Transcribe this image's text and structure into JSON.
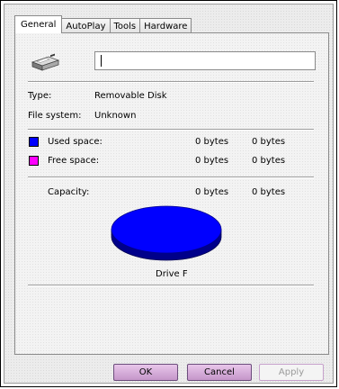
{
  "tabs": [
    {
      "label": "General",
      "active": true
    },
    {
      "label": "AutoPlay",
      "active": false
    },
    {
      "label": "Tools",
      "active": false
    },
    {
      "label": "Hardware",
      "active": false
    }
  ],
  "drive": {
    "icon": "removable-disk-icon",
    "name_value": ""
  },
  "info": {
    "type_label": "Type:",
    "type_value": "Removable Disk",
    "fs_label": "File system:",
    "fs_value": "Unknown"
  },
  "space": {
    "used_label": "Used space:",
    "used_bytes": "0 bytes",
    "used_size": "0 bytes",
    "used_color": "#0000ff",
    "free_label": "Free space:",
    "free_bytes": "0 bytes",
    "free_size": "0 bytes",
    "free_color": "#ff00ff",
    "capacity_label": "Capacity:",
    "capacity_bytes": "0 bytes",
    "capacity_size": "0 bytes"
  },
  "pie_caption": "Drive F",
  "buttons": {
    "ok": "OK",
    "cancel": "Cancel",
    "apply": "Apply"
  }
}
